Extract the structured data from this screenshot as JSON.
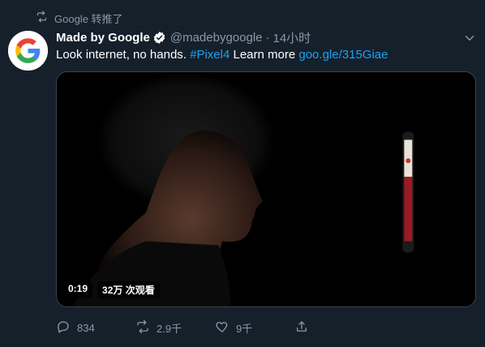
{
  "retweet": {
    "label": "Google 转推了",
    "icon": "retweet-icon"
  },
  "tweet": {
    "display_name": "Made by Google",
    "verified_icon": "verified-badge-icon",
    "handle": "@madebygoogle",
    "separator": "·",
    "time": "14小时",
    "text_plain": "Look internet, no hands. ",
    "hashtag": "#Pixel4",
    "text_mid": " Learn more ",
    "link": "goo.gle/315Giae"
  },
  "media": {
    "duration": "0:19",
    "views": "32万 次观看"
  },
  "actions": {
    "reply_count": "834",
    "retweet_count": "2.9千",
    "like_count": "9千"
  },
  "colors": {
    "background": "#15202b",
    "secondary_text": "#8899a6",
    "link": "#1da1f2",
    "border": "#38444d"
  }
}
